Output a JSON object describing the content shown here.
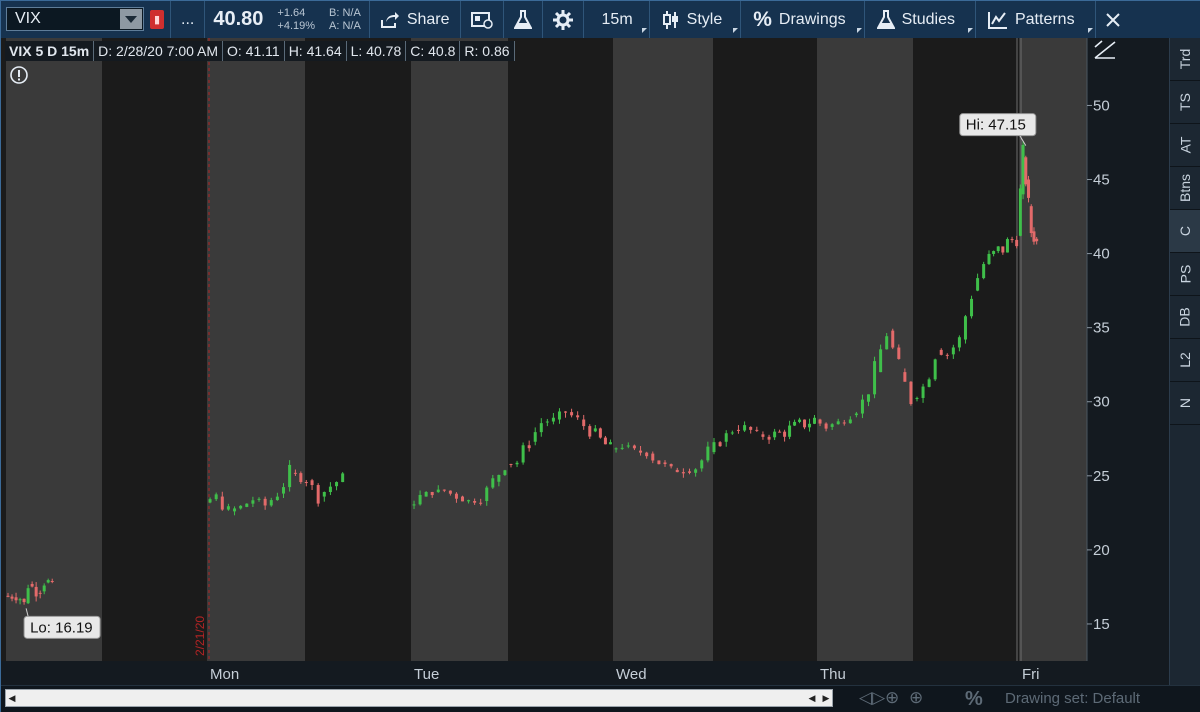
{
  "toolbar": {
    "symbol": "VIX",
    "more": "...",
    "last_price": "40.80",
    "change_abs": "+1.64",
    "change_pct": "+4.19%",
    "bid": "B: N/A",
    "ask": "A: N/A",
    "share": "Share",
    "timeframe": "15m",
    "style": "Style",
    "drawings": "Drawings",
    "studies": "Studies",
    "patterns": "Patterns"
  },
  "info": {
    "symbol": "VIX 5 D 15m",
    "date": "D: 2/28/20 7:00 AM",
    "open": "O: 41.11",
    "high": "H: 41.64",
    "low": "L: 40.78",
    "close": "C: 40.8",
    "range": "R: 0.86"
  },
  "right_tabs": [
    "Trd",
    "TS",
    "AT",
    "Btns",
    "C",
    "PS",
    "DB",
    "L2",
    "N"
  ],
  "bottom": {
    "drawing_set": "Drawing set: Default"
  },
  "chart_data": {
    "type": "candlestick",
    "ylim": [
      12.5,
      53
    ],
    "yticks": [
      15,
      20,
      25,
      30,
      35,
      40,
      45,
      50
    ],
    "day_labels": [
      "Mon",
      "Tue",
      "Wed",
      "Thu",
      "Fri"
    ],
    "date_marker": "2/21/20",
    "hi_label": "Hi: 47.15",
    "lo_label": "Lo: 16.19",
    "last_label": "40.8",
    "last_value": 40.8,
    "hi_value": 47.15,
    "lo_value": 16.19,
    "close_path": [
      [
        0,
        16.9
      ],
      [
        0.04,
        16.8
      ],
      [
        0.08,
        16.7
      ],
      [
        0.1,
        16.4
      ],
      [
        0.12,
        17.7
      ],
      [
        0.14,
        17.5
      ],
      [
        0.16,
        17.1
      ],
      [
        0.18,
        17.2
      ],
      [
        0.2,
        17.8
      ],
      [
        0.22,
        17.9
      ],
      [
        0.24,
        17.6
      ],
      [
        1.0,
        23.2
      ],
      [
        1.06,
        23.6
      ],
      [
        1.12,
        22.6
      ],
      [
        1.18,
        22.9
      ],
      [
        1.24,
        23.4
      ],
      [
        1.3,
        23.0
      ],
      [
        1.36,
        23.8
      ],
      [
        1.42,
        25.2
      ],
      [
        1.5,
        24.7
      ],
      [
        1.56,
        23.6
      ],
      [
        1.62,
        24.3
      ],
      [
        1.68,
        24.9
      ],
      [
        2.0,
        23.0
      ],
      [
        2.06,
        23.6
      ],
      [
        2.12,
        23.9
      ],
      [
        2.18,
        24.0
      ],
      [
        2.24,
        23.6
      ],
      [
        2.3,
        23.3
      ],
      [
        2.36,
        23.3
      ],
      [
        2.42,
        24.6
      ],
      [
        2.48,
        25.8
      ],
      [
        2.54,
        25.9
      ],
      [
        2.6,
        27.3
      ],
      [
        2.66,
        28.6
      ],
      [
        2.72,
        28.8
      ],
      [
        2.78,
        29.3
      ],
      [
        2.84,
        28.8
      ],
      [
        2.9,
        28.0
      ],
      [
        3.0,
        26.8
      ],
      [
        3.06,
        27.0
      ],
      [
        3.12,
        26.7
      ],
      [
        3.18,
        26.5
      ],
      [
        3.24,
        25.9
      ],
      [
        3.3,
        25.4
      ],
      [
        3.36,
        25.3
      ],
      [
        3.42,
        25.5
      ],
      [
        3.48,
        26.6
      ],
      [
        3.54,
        27.3
      ],
      [
        3.6,
        28.1
      ],
      [
        3.66,
        28.3
      ],
      [
        3.72,
        27.8
      ],
      [
        3.78,
        27.6
      ],
      [
        4.0,
        28.8
      ],
      [
        4.06,
        28.3
      ],
      [
        4.12,
        28.6
      ],
      [
        4.18,
        29.1
      ],
      [
        4.24,
        30.0
      ],
      [
        4.3,
        32.0
      ],
      [
        4.36,
        34.8
      ],
      [
        4.42,
        32.0
      ],
      [
        4.48,
        30.2
      ],
      [
        4.54,
        31.0
      ],
      [
        4.6,
        33.5
      ],
      [
        4.66,
        33.2
      ],
      [
        4.72,
        34.2
      ],
      [
        4.78,
        37.5
      ],
      [
        4.84,
        39.3
      ],
      [
        5.0,
        41.2
      ],
      [
        5.04,
        44.0
      ],
      [
        5.08,
        46.5
      ],
      [
        5.12,
        45.0
      ],
      [
        5.16,
        43.2
      ],
      [
        5.2,
        41.5
      ],
      [
        5.24,
        41.0
      ],
      [
        5.28,
        40.8
      ]
    ]
  }
}
